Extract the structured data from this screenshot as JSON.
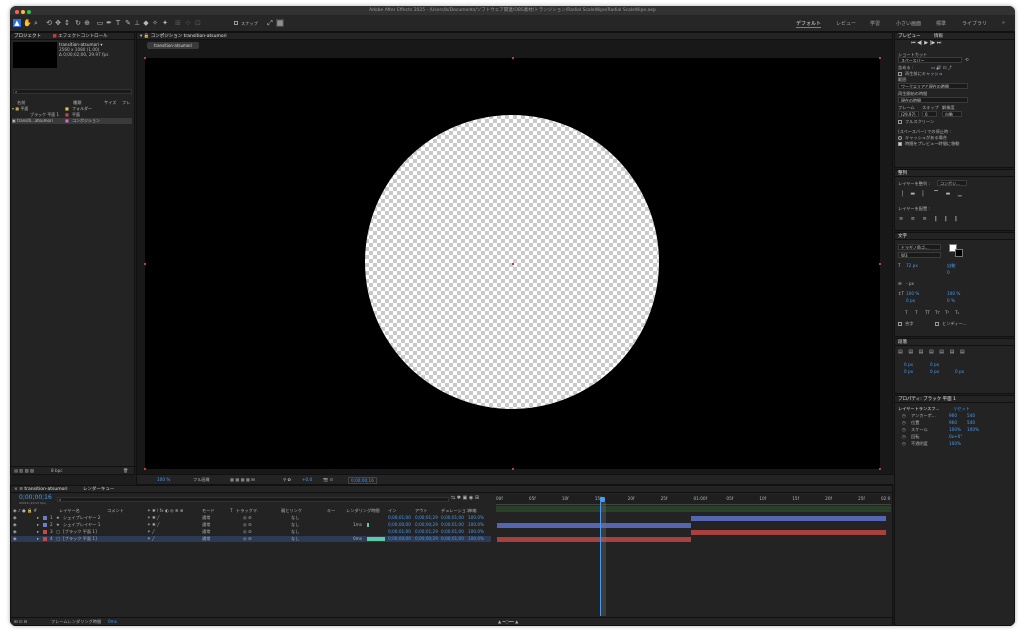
{
  "window": {
    "title": "Adobe After Effects 2025 - /Users/b/Documents/ソフトウェア関連/OBS素材/トランジション/Radial ScaleWipe/Radial ScaleWipe.aep"
  },
  "toolbar": {
    "snap_label": "スナップ",
    "workspaces": [
      "デフォルト",
      "レビュー",
      "学習",
      "小さい画面",
      "標準",
      "ライブラリ"
    ],
    "more": "»"
  },
  "project_panel": {
    "tabs": [
      "プロジェクト",
      "エフェクトコントロール"
    ],
    "comp_name": "transition-atsumori ▾",
    "comp_info": [
      "2560 x 1080 (1.00)",
      "Δ 0;00;02;00, 29.97 fps"
    ],
    "search_placeholder": "",
    "columns": [
      "名前",
      "種類",
      "サイズ",
      "フレ"
    ],
    "rows": [
      {
        "name": "平面",
        "type": "フォルダー"
      },
      {
        "name": "ブラック 平面 1",
        "type": "平面"
      },
      {
        "name": "transiti...atsumori",
        "type": "コンポジション"
      }
    ],
    "footer": "8 bpc"
  },
  "comp_panel": {
    "tab": "コンポジション transition-atsumori",
    "subtab": "transition-atsumori",
    "zoom": "100 %",
    "quality": "フル画質",
    "offset": "+0.0",
    "timecode": "0;00;00;16"
  },
  "preview_panel": {
    "tabs": [
      "プレビュー",
      "情報"
    ],
    "shortcut_label": "ショートカット",
    "shortcut_value": "スペースバー",
    "include_label": "含める :",
    "cache_label": "再生前にキャッシュ",
    "range_label": "範囲",
    "range_value": "ワークエリアと現在の時間",
    "start_label": "再生開始の時間",
    "start_value": "現在の時間",
    "frame_label": "フレーム",
    "skip_label": "スキップ",
    "res_label": "解像度",
    "frame_value": "(29.97)",
    "skip_value": "0",
    "res_value": "自動",
    "fullscreen_label": "フルスクリーン",
    "stop_label": "(スペースバー) での停止時 :",
    "opt1": "キャッシュがある場合",
    "opt2": "時間をプレビュー時間に移動"
  },
  "align_panel": {
    "title": "整列",
    "align_label": "レイヤーを整列 :",
    "align_value": "コンポジ...",
    "distribute_label": "レイヤーを配置 :"
  },
  "text_panel": {
    "title": "文字",
    "font": "ヒラギノ角ゴ...",
    "style": "W3",
    "size": "72 px",
    "leading": "自動",
    "kerning": "0",
    "stroke": "- px",
    "vscale": "100 %",
    "hscale": "100 %",
    "baseline": "0 px",
    "tsume": "0 %",
    "styles": [
      "T",
      "T",
      "TT",
      "Tт",
      "T¹",
      "T₁"
    ],
    "ligature_label": "合字",
    "hindi_label": "ヒンディー..."
  },
  "paragraph_panel": {
    "title": "段落",
    "indent_values": [
      "0 px",
      "0 px",
      "0 px",
      "0 px",
      "0 px"
    ]
  },
  "properties_panel": {
    "title": "プロパティ: ブラック 平面 1",
    "section": "レイヤートランスフ...",
    "reset": "リセット",
    "props": [
      {
        "name": "アンカーポ...",
        "v1": "960",
        "v2": "540"
      },
      {
        "name": "位置",
        "v1": "960",
        "v2": "540"
      },
      {
        "name": "スケール",
        "v1": "100%",
        "v2": "100%"
      },
      {
        "name": "回転",
        "v1": "0x+0°",
        "v2": ""
      },
      {
        "name": "不透明度",
        "v1": "100%",
        "v2": ""
      }
    ]
  },
  "timeline": {
    "tabs": [
      "transition-atsumori",
      "レンダーキュー"
    ],
    "timecode": "0;00;00;16",
    "subtime": "00016 (29.97 fps)",
    "columns": [
      "レイヤー名",
      "コメント",
      "モード",
      "T",
      "トラックマ.",
      "親とリンク",
      "キー",
      "レンダリング時間",
      "イン",
      "アウト",
      "デュレーション",
      "伸縮"
    ],
    "ruler": [
      "00f",
      "05f",
      "10f",
      "15f",
      "20f",
      "25f",
      "01:00f",
      "05f",
      "10f",
      "15f",
      "20f",
      "25f",
      "02:0"
    ],
    "layers": [
      {
        "num": "1",
        "name": "シェイプレイヤー 2",
        "color": "#6f7cc8",
        "mode": "通常",
        "track": "なし",
        "parent": "なし",
        "render": "",
        "in": "0;00;01;00",
        "out": "0;00;01;29",
        "dur": "0;00;01;00",
        "stretch": "100.0%"
      },
      {
        "num": "2",
        "name": "シェイプレイヤー 1",
        "color": "#6f7cc8",
        "mode": "通常",
        "track": "なし",
        "parent": "なし",
        "render": "1ms",
        "in": "0;00;00;00",
        "out": "0;00;00;29",
        "dur": "0;00;01;00",
        "stretch": "100.0%"
      },
      {
        "num": "3",
        "name": "[ブラック 平面 1]",
        "color": "#c74a4a",
        "mode": "通常",
        "track": "なし",
        "parent": "なし",
        "render": "",
        "in": "0;00;01;00",
        "out": "0;00;01;29",
        "dur": "0;00;01;00",
        "stretch": "100.0%"
      },
      {
        "num": "4",
        "name": "[ブラック 平面 1]",
        "color": "#c74a4a",
        "mode": "通常",
        "track": "なし",
        "parent": "なし",
        "render": "0ms",
        "in": "0;00;00;00",
        "out": "0;00;00;29",
        "dur": "0;00;01;00",
        "stretch": "100.0%"
      }
    ],
    "footer": "フレームレンダリング時間",
    "footer_value": "0ms"
  },
  "colors": {
    "accent": "#2e8bff",
    "shape": "#6f7cc8",
    "solid": "#c74a4a",
    "panel": "#232323"
  }
}
